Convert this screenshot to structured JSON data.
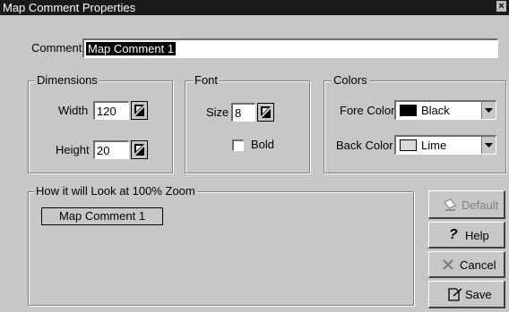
{
  "window": {
    "title": "Map Comment Properties",
    "close_glyph": "×"
  },
  "comment": {
    "label": "Comment",
    "value": "Map Comment 1"
  },
  "dimensions": {
    "group_label": "Dimensions",
    "width_label": "Width",
    "width_value": "120",
    "height_label": "Height",
    "height_value": "20"
  },
  "font": {
    "group_label": "Font",
    "size_label": "Size",
    "size_value": "8",
    "bold_label": "Bold",
    "bold_checked": false
  },
  "colors": {
    "group_label": "Colors",
    "fore_label": "Fore Color",
    "fore_value": "Black",
    "fore_swatch": "#000000",
    "back_label": "Back Color",
    "back_value": "Lime",
    "back_swatch": "#d9d9d9"
  },
  "preview": {
    "group_label": "How it will Look at 100% Zoom",
    "sample_text": "Map Comment 1"
  },
  "buttons": {
    "default": "Default",
    "help": "Help",
    "cancel": "Cancel",
    "save": "Save"
  }
}
